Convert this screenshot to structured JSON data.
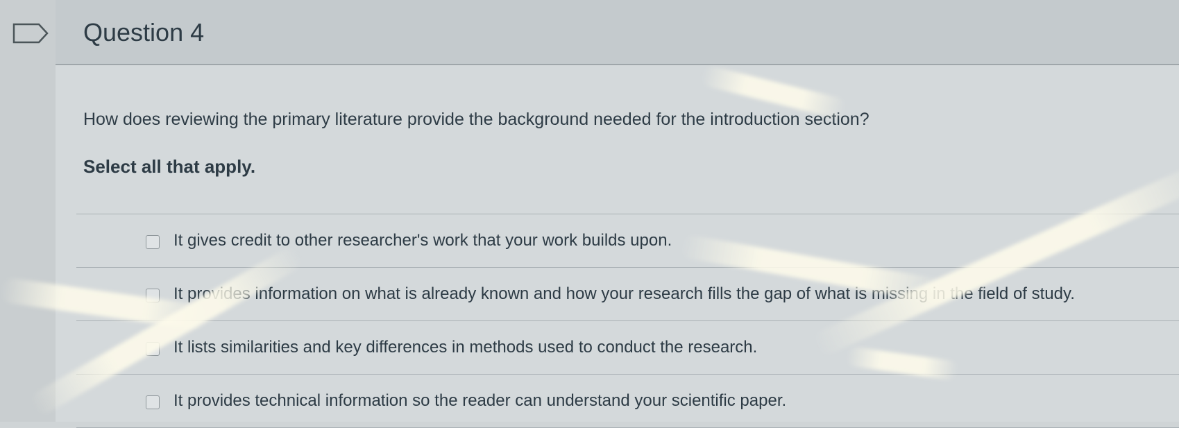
{
  "question": {
    "title": "Question 4",
    "text": "How does reviewing the primary literature provide the background needed for the introduction section?",
    "instruction": "Select all that apply."
  },
  "answers": [
    {
      "label": "It gives credit to other researcher's work that your work builds upon.",
      "checked": false
    },
    {
      "label": "It provides information on what is already known and how your research fills the gap of what is missing in the field of study.",
      "checked": false
    },
    {
      "label": "It lists similarities and key differences in methods used to conduct the research.",
      "checked": false
    },
    {
      "label": "It provides technical information so the reader can understand your scientific paper.",
      "checked": false
    }
  ]
}
